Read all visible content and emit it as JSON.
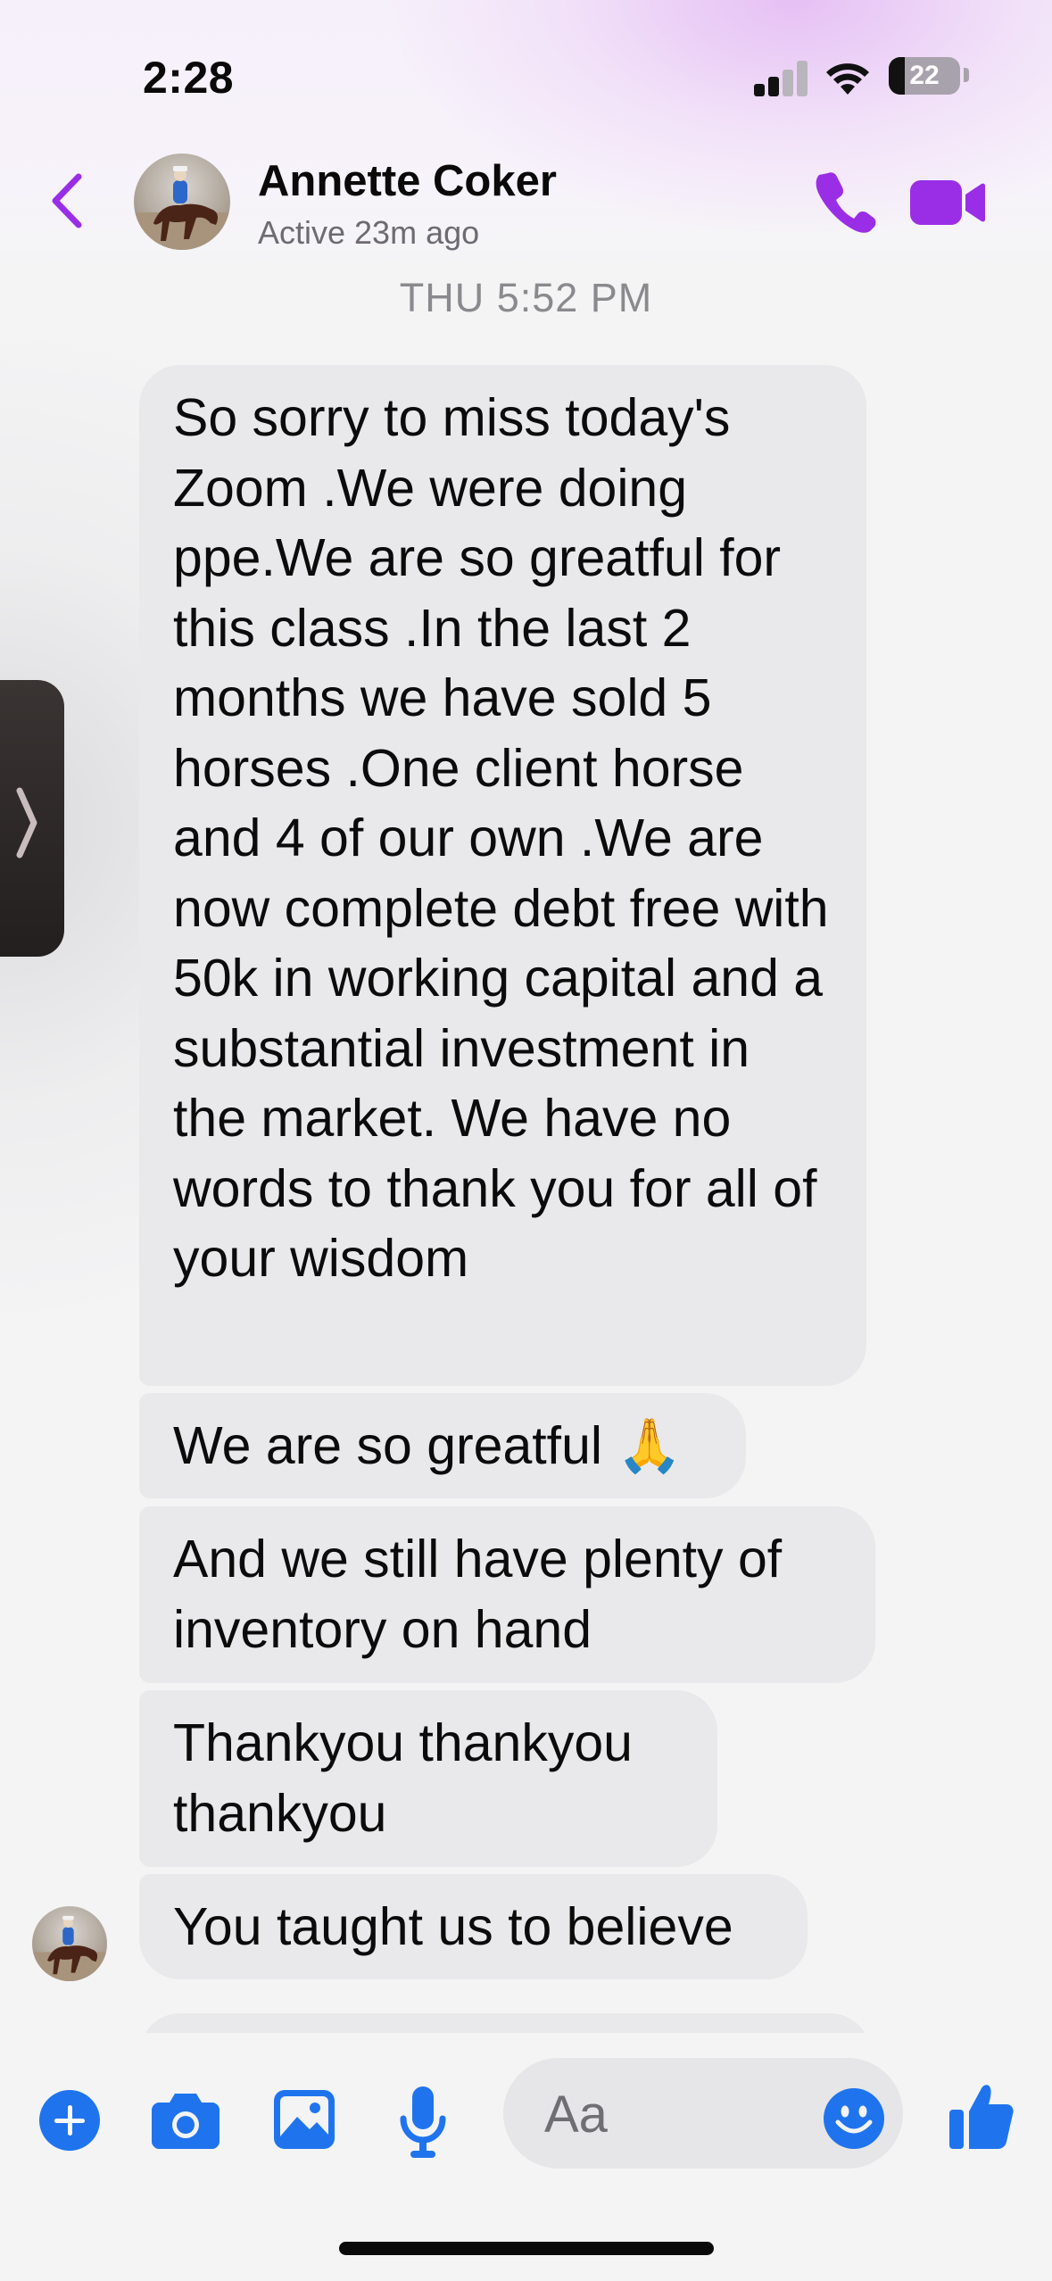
{
  "status_bar": {
    "time": "2:28",
    "battery_level": "22",
    "icons": [
      "cellular-signal-icon",
      "wifi-icon",
      "battery-icon"
    ]
  },
  "header": {
    "contact_name": "Annette Coker",
    "contact_status": "Active 23m ago",
    "icons": [
      "back-chevron-icon",
      "phone-icon",
      "video-camera-icon"
    ]
  },
  "thread": {
    "timestamp": "THU 5:52 PM",
    "messages": [
      {
        "text": "So sorry to miss today's Zoom .We were doing ppe.We are so greatful for this class .In the last 2 months we have sold 5 horses .One client horse and 4 of our own .We are now complete debt free with 50k in working capital and a substantial investment in the market. We have no words to thank you for all of your wisdom"
      },
      {
        "text": "We are so greatful 🙏"
      },
      {
        "text": "And we still have plenty of inventory on hand"
      },
      {
        "text": "Thankyou thankyou thankyou"
      },
      {
        "text": "You taught us to believe"
      }
    ]
  },
  "composer": {
    "placeholder": "Aa",
    "icons": [
      "plus-icon",
      "camera-icon",
      "image-icon",
      "microphone-icon",
      "emoji-icon",
      "thumbs-up-icon"
    ]
  },
  "colors": {
    "accent_purple": "#9a2ee6",
    "accent_blue": "#1f74ee",
    "bubble_gray": "#e9e9eb"
  }
}
